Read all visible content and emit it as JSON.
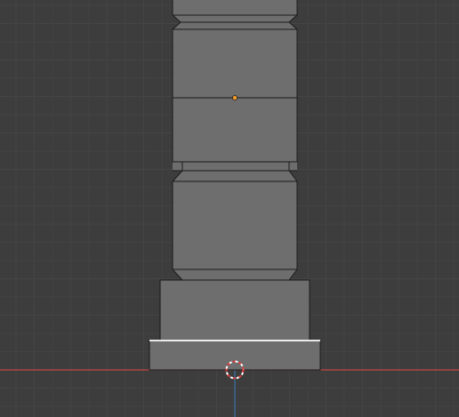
{
  "viewport": {
    "background": "#3d3d3d",
    "grid_minor_color": "#444444",
    "grid_major_color": "#4a4a4a",
    "x_axis_color": "#c14646",
    "z_axis_color": "#3b71a8"
  },
  "mesh": {
    "face_color": "#6e6e6e",
    "edge_color": "#1b1b1b",
    "selected_edge_color": "#ffffff",
    "origin_point_color": "#f39c2b"
  },
  "cursor_3d": {
    "icon": "3d-cursor-icon",
    "ring_colors": [
      "#e03c3c",
      "#ffffff"
    ]
  }
}
